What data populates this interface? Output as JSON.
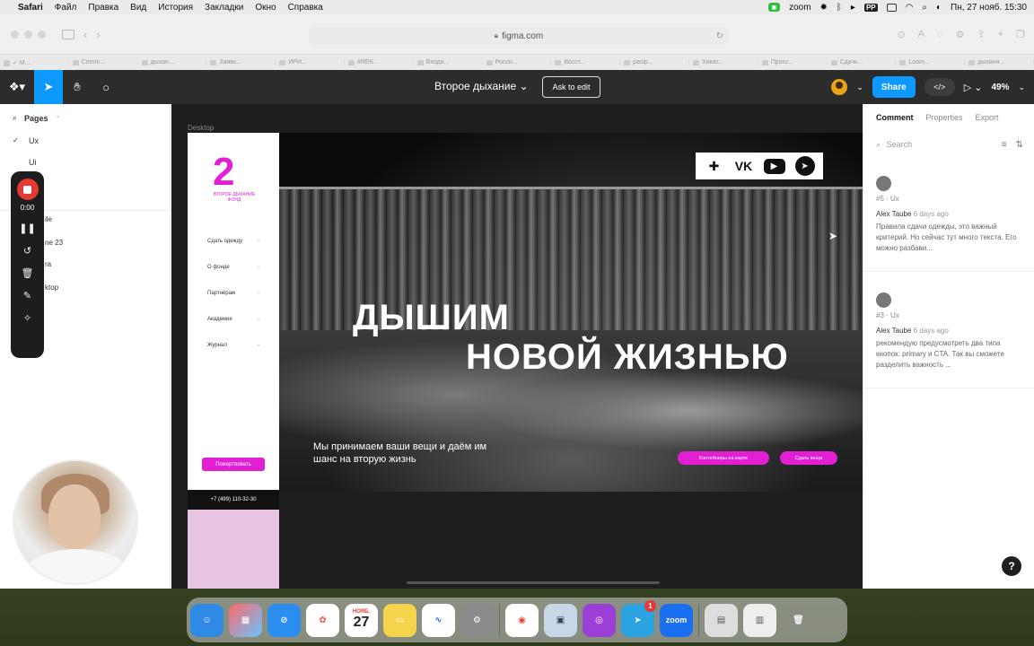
{
  "menubar": {
    "app": "Safari",
    "items": [
      "Файл",
      "Правка",
      "Вид",
      "История",
      "Закладки",
      "Окно",
      "Справка"
    ],
    "zoom_label": "zoom",
    "clock": "Пн, 27 нояб. 15:30"
  },
  "browser": {
    "url": "figma.com",
    "tabs": [
      "✓ М...",
      "Comm...",
      "дыхан...",
      "Заявк...",
      "ИРИ...",
      "#REK...",
      "Входя...",
      "Росси...",
      "Восст...",
      "paslp...",
      "Хакат...",
      "Прого...",
      "Сдачк...",
      "Loom...",
      "дыхани..."
    ]
  },
  "figma": {
    "file_title": "Второе дыхание",
    "ask_edit": "Ask to edit",
    "share": "Share",
    "zoom": "49%",
    "code_label": "</>"
  },
  "left_panel": {
    "pages_label": "Pages",
    "pages": [
      "Ux",
      "Ui",
      "uide"
    ],
    "layers": [
      "ile",
      "ne 23",
      "ra",
      "ktop"
    ],
    "recorder_time": "0:00"
  },
  "canvas": {
    "frame_label": "Desktop",
    "logo_num": "2",
    "logo_text": "ВТОРОЕ ДЫХАНИЕ ФОНД",
    "nav": [
      "Сдать одежду",
      "О фонде",
      "Партнёрам",
      "Академия",
      "Журнал"
    ],
    "donate": "Пожертвовать",
    "phone": "+7 (499) 110-32-30",
    "hero_line1": "ДЫШИМ",
    "hero_line2": "НОВОЙ ЖИЗНЬЮ",
    "hero_sub": "Мы принимаем ваши вещи и даём им шанс на вторую жизнь",
    "btn_containers": "Контейнеры на карте",
    "btn_donate_clothes": "Сдать вещи",
    "social": [
      "ok",
      "vk",
      "youtube",
      "telegram"
    ]
  },
  "right_panel": {
    "tabs": [
      "Comment",
      "Properties",
      "Export"
    ],
    "search_placeholder": "Search",
    "comments": [
      {
        "ref": "#5 · Ux",
        "author": "Alex Taube",
        "ago": "6 days ago",
        "text": "Правила сдачи одежды, это важный критерий. Но сейчас тут много текста. Его можно разбави..."
      },
      {
        "ref": "#3 · Ux",
        "author": "Alex Taube",
        "ago": "6 days ago",
        "text": "рекомендую предусмотреть два типа кнопок: primary и CTA. Так вы сможете разделить важность ..."
      }
    ],
    "help": "?"
  },
  "dock": {
    "calendar_month": "НОЯБ.",
    "calendar_day": "27",
    "telegram_badge": "1",
    "zoom_label": "zoom"
  }
}
